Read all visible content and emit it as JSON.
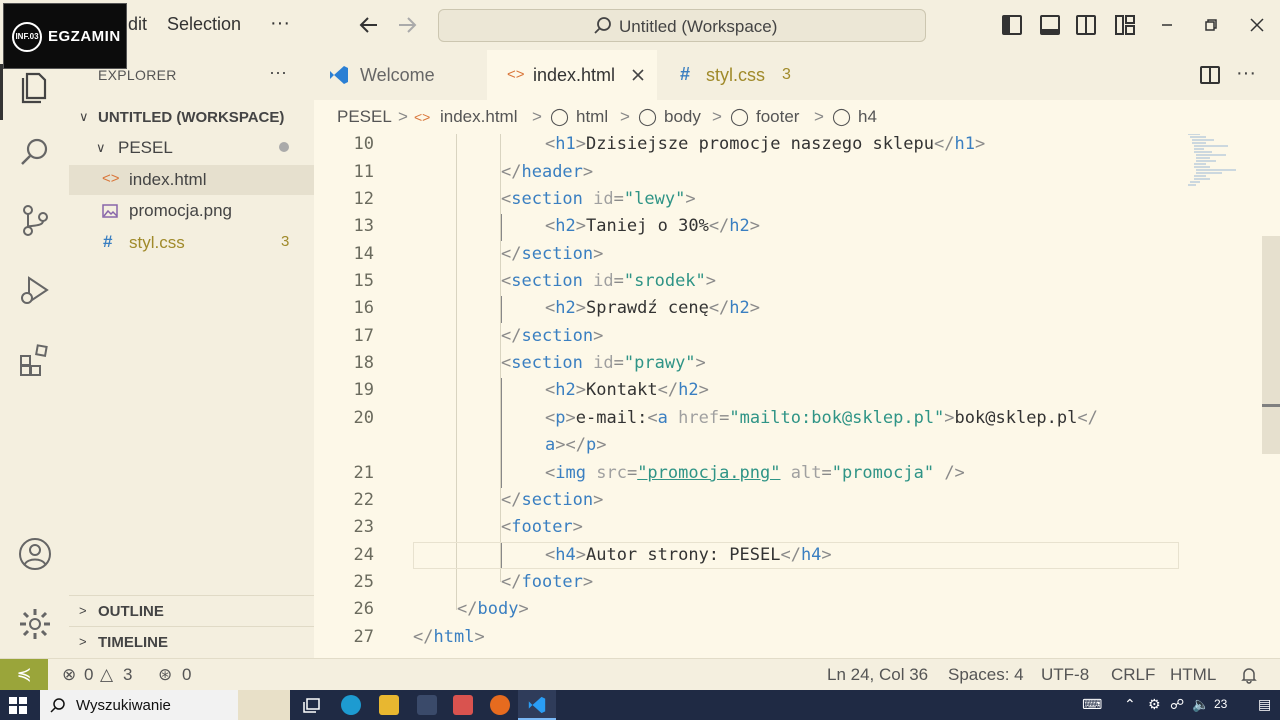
{
  "overlay": {
    "badge": "EGZAMIN",
    "circle": "INF.03"
  },
  "menu": {
    "edit": "dit",
    "selection": "Selection",
    "more": "···"
  },
  "titlebar": {
    "search": "Untitled (Workspace)"
  },
  "sidebar": {
    "header": "EXPLORER",
    "workspace": "UNTITLED (WORKSPACE)",
    "folder": "PESEL",
    "files": [
      {
        "name": "index.html",
        "icon": "html-file-icon",
        "badge": ""
      },
      {
        "name": "promocja.png",
        "icon": "image-file-icon",
        "badge": ""
      },
      {
        "name": "styl.css",
        "icon": "css-file-icon",
        "badge": "3"
      }
    ],
    "outline": "OUTLINE",
    "timeline": "TIMELINE"
  },
  "tabs": [
    {
      "label": "Welcome",
      "icon": "vscode-icon"
    },
    {
      "label": "index.html",
      "icon": "html-icon"
    },
    {
      "label": "styl.css",
      "icon": "css-hash-icon",
      "badge": "3"
    }
  ],
  "breadcrumb": [
    "PESEL",
    "index.html",
    "html",
    "body",
    "footer",
    "h4"
  ],
  "code": {
    "l10": "10",
    "l11": "11",
    "l12": "12",
    "l13": "13",
    "l14": "14",
    "l15": "15",
    "l16": "16",
    "l17": "17",
    "l18": "18",
    "l19": "19",
    "l20": "20",
    "l21": "21",
    "l22": "22",
    "l23": "23",
    "l24": "24",
    "l25": "25",
    "l26": "26",
    "l27": "27",
    "h1": "h1",
    "h1_text": "Dzisiejsze promocje naszego sklepu",
    "header": "header",
    "section": "section",
    "id": "id",
    "lewy": "\"lewy\"",
    "srodek": "\"srodek\"",
    "prawy": "\"prawy\"",
    "h2": "h2",
    "taniej": "Taniej o 30%",
    "sprawdz": "Sprawdź cenę",
    "kontakt": "Kontakt",
    "p": "p",
    "email": "e-mail:",
    "a": "a",
    "href": "href",
    "mailto": "\"mailto:bok@sklep.pl\"",
    "bok": "bok@sklep.pl",
    "img": "img",
    "src": "src",
    "promocja_png": "\"promocja.png\"",
    "alt": "alt",
    "promocja": "\"promocja\"",
    "footer": "footer",
    "h4": "h4",
    "autor": "Autor strony: PESEL",
    "body": "body",
    "html": "html"
  },
  "status": {
    "errors": "0",
    "warnings": "3",
    "ports": "0",
    "position": "Ln 24, Col 36",
    "spaces": "Spaces: 4",
    "encoding": "UTF-8",
    "eol": "CRLF",
    "language": "HTML"
  },
  "taskbar": {
    "search": "Wyszukiwanie",
    "tray_num": "23"
  }
}
